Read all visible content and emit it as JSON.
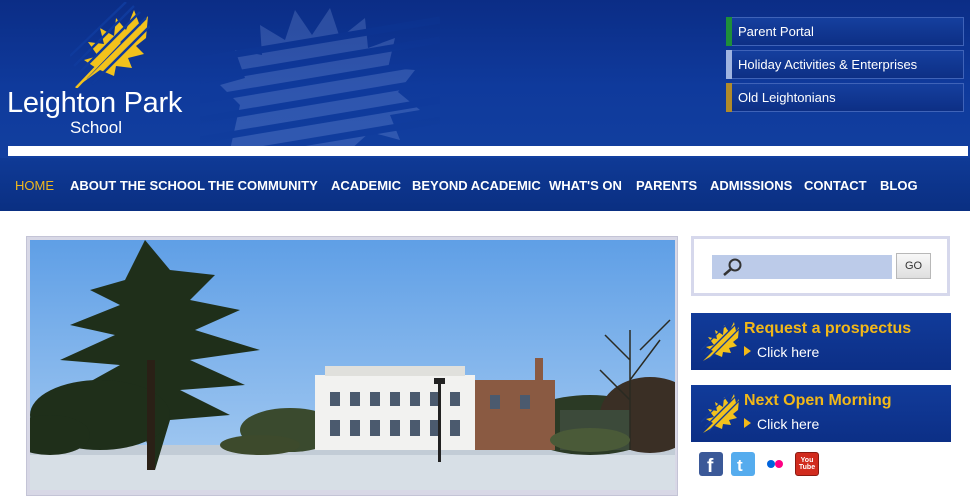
{
  "logo": {
    "name": "Leighton Park",
    "subtitle": "School"
  },
  "quick_links": [
    {
      "label": "Parent Portal",
      "accent": "#1e8f3a"
    },
    {
      "label": "Holiday Activities & Enterprises",
      "accent": "#9fb4e0"
    },
    {
      "label": "Old Leightonians",
      "accent": "#b08a2a"
    }
  ],
  "nav": {
    "items": [
      {
        "label": "HOME",
        "active": true
      },
      {
        "label": "ABOUT THE SCHOOL"
      },
      {
        "label": "THE COMMUNITY"
      },
      {
        "label": "ACADEMIC"
      },
      {
        "label": "BEYOND ACADEMIC"
      },
      {
        "label": "WHAT'S ON"
      },
      {
        "label": "PARENTS"
      },
      {
        "label": "ADMISSIONS"
      },
      {
        "label": "CONTACT"
      },
      {
        "label": "BLOG"
      }
    ]
  },
  "search": {
    "placeholder": "",
    "go_label": "GO"
  },
  "promos": [
    {
      "title": "Request a prospectus",
      "link": "Click here"
    },
    {
      "title": "Next Open Morning",
      "link": "Click here"
    }
  ],
  "social": {
    "youtube_label": "You Tube"
  },
  "colors": {
    "brand_blue": "#0f3a9c",
    "accent_gold": "#f2b818"
  }
}
